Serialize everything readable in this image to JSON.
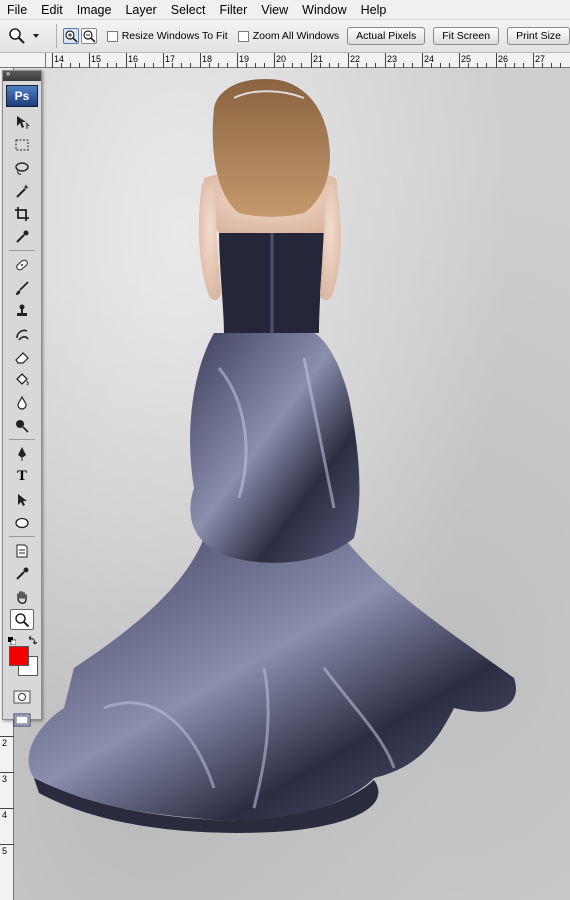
{
  "menu": [
    "File",
    "Edit",
    "Image",
    "Layer",
    "Select",
    "Filter",
    "View",
    "Window",
    "Help"
  ],
  "options": {
    "resize_label": "Resize Windows To Fit",
    "zoom_all_label": "Zoom All Windows",
    "actual_pixels": "Actual Pixels",
    "fit_screen": "Fit Screen",
    "print_size": "Print Size"
  },
  "rulers": {
    "top_labels": [
      "14",
      "15",
      "16",
      "17",
      "18",
      "19",
      "20",
      "21",
      "22",
      "23",
      "24",
      "25",
      "26",
      "27"
    ],
    "left_labels": [
      "2",
      "3",
      "4",
      "5"
    ]
  },
  "tools_panel": {
    "logo": "Ps",
    "head": "››",
    "type_tool_glyph": "T"
  },
  "colors": {
    "foreground": "#f20000",
    "background": "#ffffff"
  }
}
